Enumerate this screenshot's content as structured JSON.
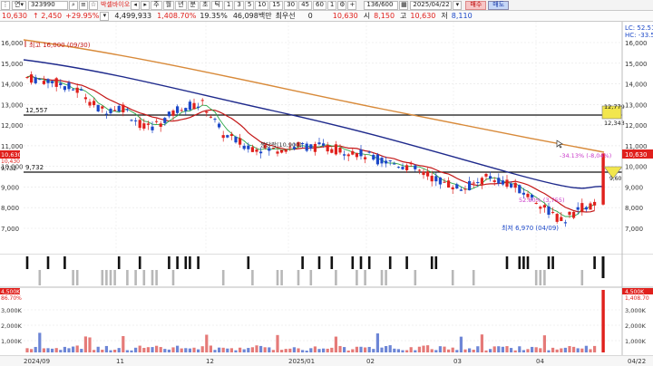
{
  "toolbar": {
    "mode_label": "연",
    "code": "323990",
    "stock_name": "박셀바이오",
    "period_tabs": [
      "주",
      "월",
      "년",
      "분",
      "초",
      "틱"
    ],
    "minute_tabs": [
      "1",
      "3",
      "5",
      "10",
      "15",
      "30",
      "45",
      "60",
      "1"
    ],
    "count": "136/600",
    "date": "2025/04/22",
    "buy_label": "매수",
    "sell_label": "매도",
    "price": "10,630",
    "change": "↑ 2,450",
    "change_pct": "+29.95%",
    "volume": "4,499,933",
    "volume_pct": "1,408.70%",
    "ratio": "19.35%",
    "amount": "46,098백만",
    "priority_label": "최우선",
    "priority_value": "0",
    "summary": {
      "price": "10,630",
      "open_label": "시",
      "open": "8,150",
      "high_label": "고",
      "high": "10,630",
      "low_label": "저",
      "low": "8,110"
    }
  },
  "price_axis": {
    "ticks": [
      "16,000",
      "15,000",
      "14,000",
      "13,000",
      "12,000",
      "11,000",
      "10,000",
      "9,000",
      "8,000",
      "7,000"
    ],
    "left_tags": [
      "10,630",
      "10,430",
      "9,732"
    ],
    "right_tags": [
      "LC: 52.51",
      "HC: -33.58",
      "12,779",
      "12,343",
      "10,630",
      "9,732",
      "9,60"
    ]
  },
  "annotations": {
    "max_label": "최고 16,000 (09/30)",
    "min_label": "최저 6,970 (04/09)",
    "hline_high": "12,557",
    "hline_low": "9,732",
    "right_box_top": "12,779",
    "right_box_bottom": "12,343",
    "mid_label": "봉당락(10,900)",
    "pink_label": "-34.13% (-8,04%)",
    "magenta_label": "52.80% (3,755)"
  },
  "volume_axis": {
    "left_tags": [
      "4,500K",
      "86.70%"
    ],
    "right_tags": [
      "4,500K",
      "1,408.70"
    ],
    "ticks": [
      "3,000K",
      "2,000K",
      "1,000K"
    ]
  },
  "x_axis": {
    "labels": [
      "2024/09",
      "11",
      "12",
      "2025/01",
      "02",
      "03",
      "04",
      "04/22"
    ]
  },
  "colors": {
    "up": "#e0201c",
    "down": "#1c48c8",
    "ma_long": "#d88a3a",
    "ma_mid": "#1f2a8c",
    "ma_short": "#c41818",
    "accent_yellow": "#f2e64d"
  }
}
